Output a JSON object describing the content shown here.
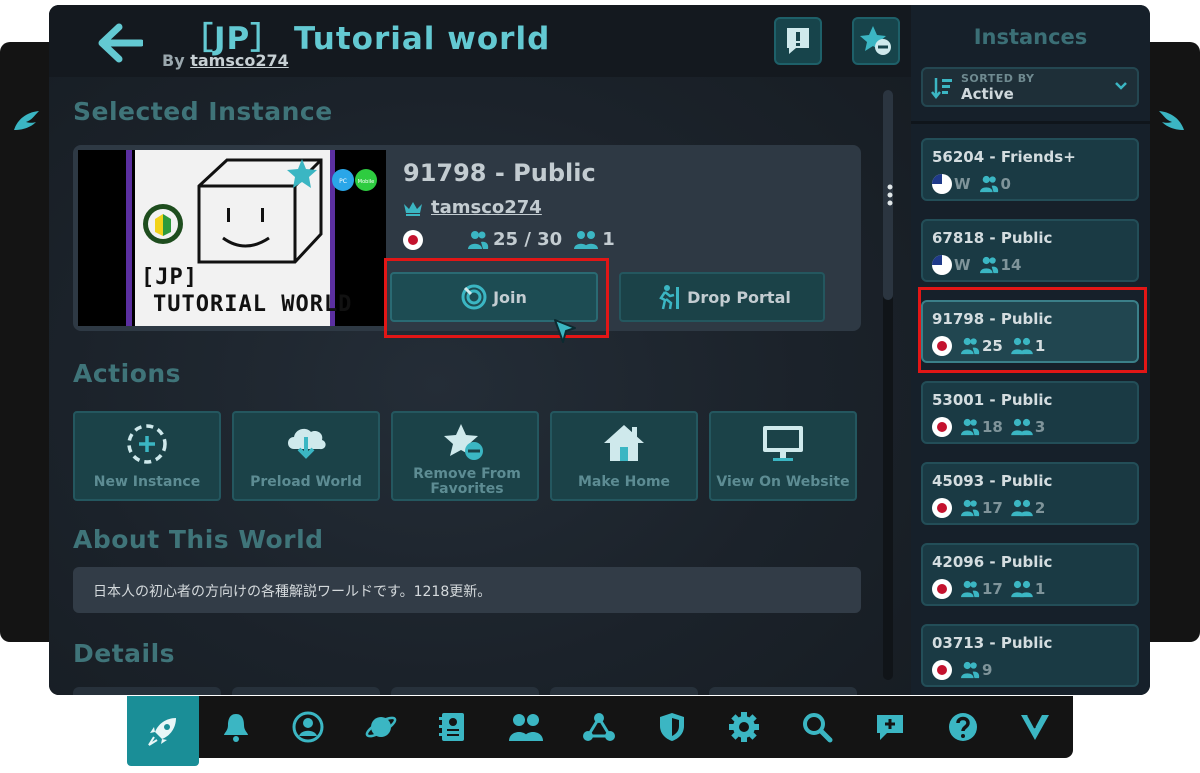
{
  "header": {
    "title": "［JP］ Tutorial world",
    "by_label": "By",
    "author": "tamsco274"
  },
  "selected_instance": {
    "section_title": "Selected Instance",
    "name": "91798 - Public",
    "owner": "tamsco274",
    "players": "25 / 30",
    "friends": "1",
    "region": "JP",
    "thumbnail_text_line1": "[JP]",
    "thumbnail_text_line2": "TUTORIAL WORLD",
    "platform_badges": [
      "PC",
      "Mobile"
    ],
    "join_label": "Join",
    "drop_portal_label": "Drop Portal"
  },
  "actions": {
    "section_title": "Actions",
    "items": [
      {
        "label": "New Instance",
        "icon": "plus-circle-dashed-icon"
      },
      {
        "label": "Preload World",
        "icon": "cloud-download-icon"
      },
      {
        "label": "Remove From Favorites",
        "icon": "star-minus-icon"
      },
      {
        "label": "Make Home",
        "icon": "home-icon"
      },
      {
        "label": "View On Website",
        "icon": "monitor-icon"
      }
    ]
  },
  "about": {
    "section_title": "About This World",
    "description": "日本人の初心者の方向けの各種解説ワールドです。1218更新。"
  },
  "details": {
    "section_title": "Details"
  },
  "sidebar": {
    "title": "Instances",
    "sorted_by_label": "SORTED BY",
    "sorted_by_value": "Active",
    "instances": [
      {
        "name": "56204 - Friends+",
        "region": "US",
        "region_label": "W",
        "players": "0",
        "friends": ""
      },
      {
        "name": "67818 - Public",
        "region": "US",
        "region_label": "W",
        "players": "14",
        "friends": ""
      },
      {
        "name": "91798 - Public",
        "region": "JP",
        "region_label": "",
        "players": "25",
        "friends": "1"
      },
      {
        "name": "53001 - Public",
        "region": "JP",
        "region_label": "",
        "players": "18",
        "friends": "3"
      },
      {
        "name": "45093 - Public",
        "region": "JP",
        "region_label": "",
        "players": "17",
        "friends": "2"
      },
      {
        "name": "42096 - Public",
        "region": "JP",
        "region_label": "",
        "players": "17",
        "friends": "1"
      },
      {
        "name": "03713 - Public",
        "region": "JP",
        "region_label": "",
        "players": "9",
        "friends": ""
      }
    ]
  },
  "bottom_nav": [
    {
      "name": "launch",
      "icon": "rocket-icon"
    },
    {
      "name": "notifications",
      "icon": "bell-icon"
    },
    {
      "name": "profile",
      "icon": "user-circle-icon"
    },
    {
      "name": "worlds",
      "icon": "planet-icon"
    },
    {
      "name": "avatars",
      "icon": "id-card-icon"
    },
    {
      "name": "social",
      "icon": "people-icon"
    },
    {
      "name": "groups",
      "icon": "network-icon"
    },
    {
      "name": "safety",
      "icon": "shield-icon"
    },
    {
      "name": "settings",
      "icon": "gear-icon"
    },
    {
      "name": "search",
      "icon": "search-icon"
    },
    {
      "name": "chat",
      "icon": "chat-plus-icon"
    },
    {
      "name": "help",
      "icon": "help-icon"
    },
    {
      "name": "vrchat",
      "icon": "vrchat-logo-icon"
    }
  ],
  "colors": {
    "accent": "#63c9d2",
    "highlight": "#e21616",
    "active_nav": "#1a8e97"
  }
}
